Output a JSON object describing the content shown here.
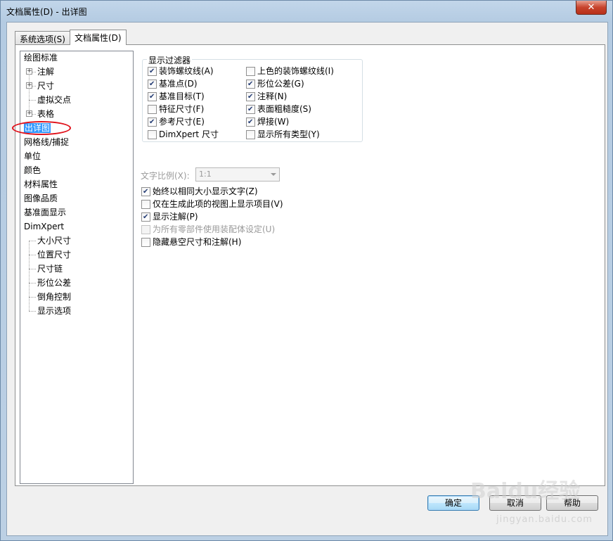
{
  "window": {
    "title": "文档属性(D) - 出详图",
    "close_glyph": "✕"
  },
  "tabs": [
    {
      "label": "系统选项(S)",
      "active": false
    },
    {
      "label": "文档属性(D)",
      "active": true
    }
  ],
  "tree": {
    "items": [
      {
        "label": "绘图标准",
        "level": 0,
        "expander": ""
      },
      {
        "label": "注解",
        "level": 1,
        "expander": "+"
      },
      {
        "label": "尺寸",
        "level": 1,
        "expander": "+"
      },
      {
        "label": "虚拟交点",
        "level": 1,
        "expander": ""
      },
      {
        "label": "表格",
        "level": 1,
        "expander": "+"
      },
      {
        "label": "出详图",
        "level": 0,
        "expander": "",
        "selected": true
      },
      {
        "label": "网格线/捕捉",
        "level": 0,
        "expander": ""
      },
      {
        "label": "单位",
        "level": 0,
        "expander": ""
      },
      {
        "label": "颜色",
        "level": 0,
        "expander": ""
      },
      {
        "label": "材料属性",
        "level": 0,
        "expander": ""
      },
      {
        "label": "图像品质",
        "level": 0,
        "expander": ""
      },
      {
        "label": "基准面显示",
        "level": 0,
        "expander": ""
      },
      {
        "label": "DimXpert",
        "level": 0,
        "expander": ""
      },
      {
        "label": "大小尺寸",
        "level": 1,
        "expander": ""
      },
      {
        "label": "位置尺寸",
        "level": 1,
        "expander": ""
      },
      {
        "label": "尺寸链",
        "level": 1,
        "expander": ""
      },
      {
        "label": "形位公差",
        "level": 1,
        "expander": ""
      },
      {
        "label": "倒角控制",
        "level": 1,
        "expander": ""
      },
      {
        "label": "显示选项",
        "level": 1,
        "expander": ""
      }
    ]
  },
  "display_filter": {
    "legend": "显示过滤器",
    "left": [
      {
        "label": "装饰螺纹线(A)",
        "checked": true
      },
      {
        "label": "基准点(D)",
        "checked": true
      },
      {
        "label": "基准目标(T)",
        "checked": true
      },
      {
        "label": "特征尺寸(F)",
        "checked": false
      },
      {
        "label": "参考尺寸(E)",
        "checked": true
      },
      {
        "label": "DimXpert 尺寸",
        "checked": false
      }
    ],
    "right": [
      {
        "label": "上色的装饰螺纹线(I)",
        "checked": false
      },
      {
        "label": "形位公差(G)",
        "checked": true
      },
      {
        "label": "注释(N)",
        "checked": true
      },
      {
        "label": "表面粗糙度(S)",
        "checked": true
      },
      {
        "label": "焊接(W)",
        "checked": true
      },
      {
        "label": "显示所有类型(Y)",
        "checked": false
      }
    ]
  },
  "text_scale": {
    "label": "文字比例(X):",
    "value": "1:1"
  },
  "options": [
    {
      "label": "始终以相同大小显示文字(Z)",
      "checked": true,
      "disabled": false
    },
    {
      "label": "仅在生成此项的视图上显示项目(V)",
      "checked": false,
      "disabled": false
    },
    {
      "label": "显示注解(P)",
      "checked": true,
      "disabled": false
    },
    {
      "label": "为所有零部件使用装配体设定(U)",
      "checked": false,
      "disabled": true
    },
    {
      "label": "隐藏悬空尺寸和注解(H)",
      "checked": false,
      "disabled": false
    }
  ],
  "buttons": {
    "ok": "确定",
    "cancel": "取消",
    "help": "帮助"
  },
  "watermark": {
    "main": "Baidu经验",
    "sub": "jingyan.baidu.com"
  }
}
